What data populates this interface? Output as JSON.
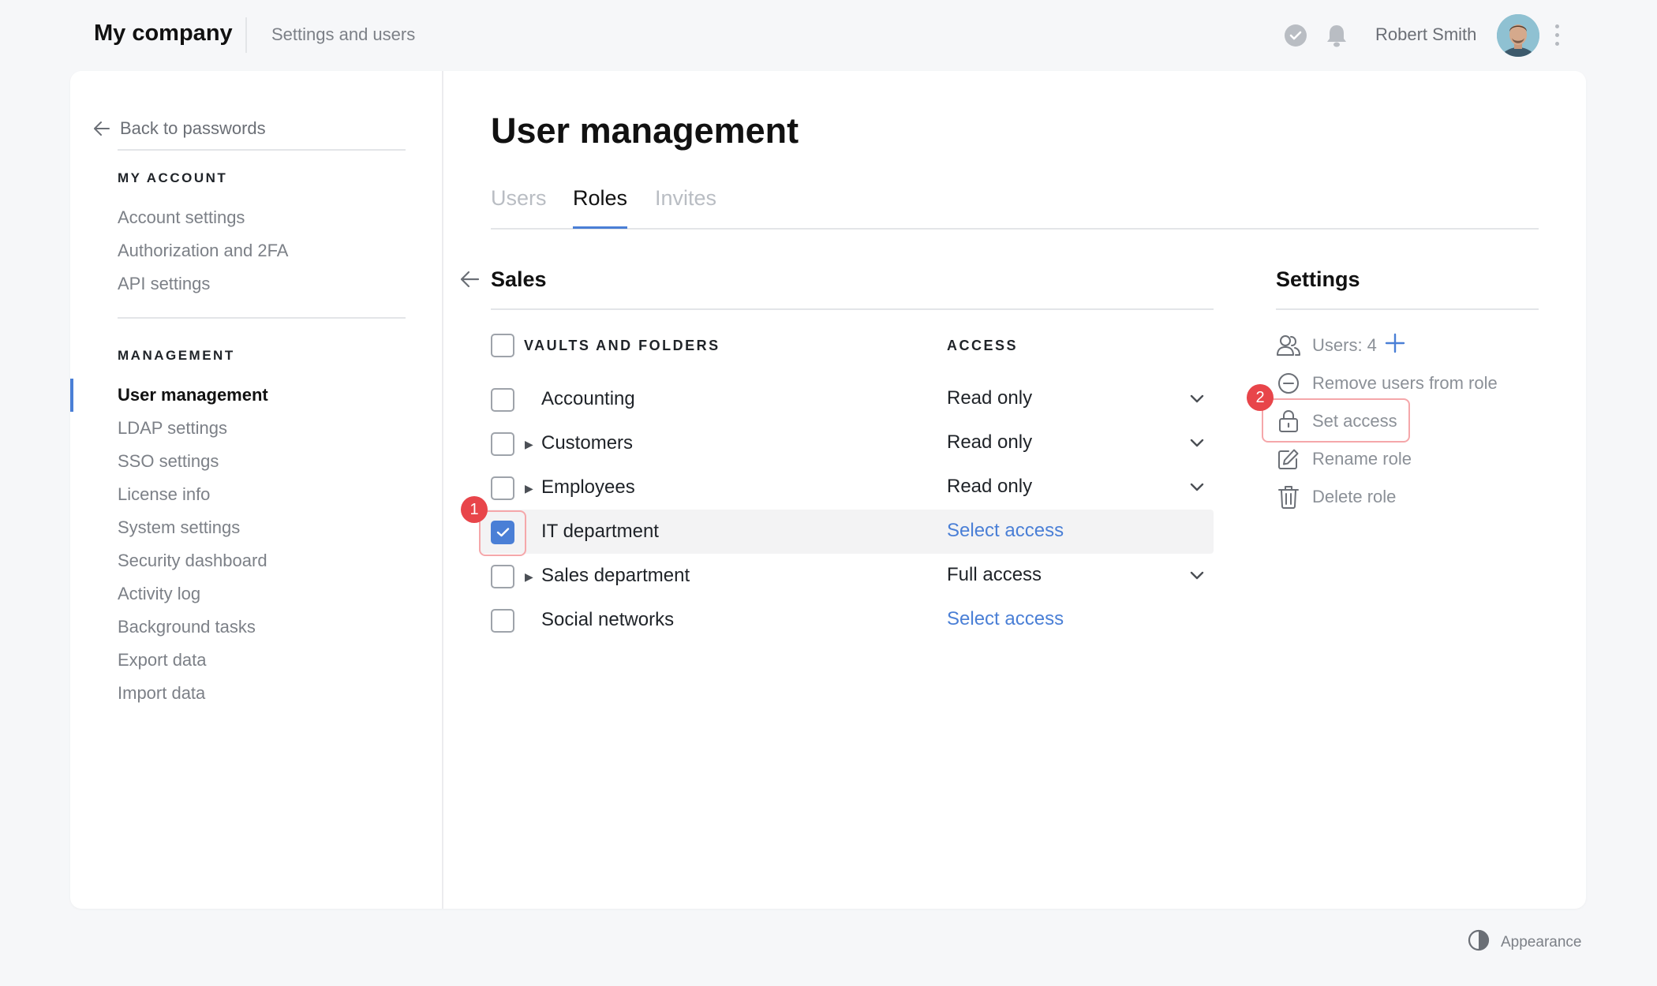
{
  "header": {
    "brand": "My company",
    "breadcrumb": "Settings and users",
    "user_name": "Robert Smith"
  },
  "sidebar": {
    "back_label": "Back to passwords",
    "my_account_heading": "MY ACCOUNT",
    "my_account_items": [
      "Account settings",
      "Authorization and 2FA",
      "API settings"
    ],
    "management_heading": "MANAGEMENT",
    "management_items": [
      "User management",
      "LDAP settings",
      "SSO settings",
      "License info",
      "System settings",
      "Security dashboard",
      "Activity log",
      "Background tasks",
      "Export data",
      "Import data"
    ],
    "active_item": "User management"
  },
  "main": {
    "title": "User management",
    "tabs": [
      "Users",
      "Roles",
      "Invites"
    ],
    "active_tab": "Roles",
    "role_name": "Sales",
    "columns": {
      "vaults": "VAULTS AND FOLDERS",
      "access": "ACCESS"
    },
    "rows": [
      {
        "name": "Accounting",
        "access": "Read only",
        "expandable": false,
        "checked": false
      },
      {
        "name": "Customers",
        "access": "Read only",
        "expandable": true,
        "checked": false
      },
      {
        "name": "Employees",
        "access": "Read only",
        "expandable": true,
        "checked": false
      },
      {
        "name": "IT department",
        "access": "Select access",
        "expandable": false,
        "checked": true
      },
      {
        "name": "Sales department",
        "access": "Full access",
        "expandable": true,
        "checked": false
      },
      {
        "name": "Social networks",
        "access": "Select access",
        "expandable": false,
        "checked": false
      }
    ]
  },
  "settings": {
    "title": "Settings",
    "users_label": "Users: 4",
    "remove_users": "Remove users from role",
    "set_access": "Set access",
    "rename_role": "Rename role",
    "delete_role": "Delete role"
  },
  "annotations": {
    "badge1": "1",
    "badge2": "2"
  },
  "footer": {
    "appearance": "Appearance"
  },
  "colors": {
    "accent": "#4a7fd6",
    "badge": "#e8454a",
    "background": "#f6f7f9"
  }
}
